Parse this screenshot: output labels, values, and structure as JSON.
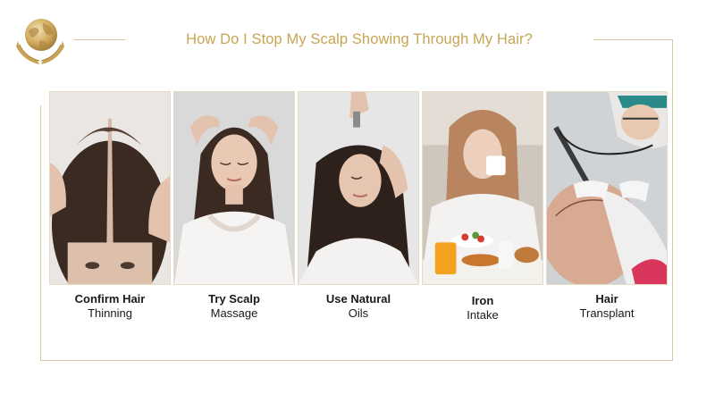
{
  "title": "How Do I Stop My Scalp Showing Through My Hair?",
  "accent_color": "#c8a553",
  "logo": {
    "icon": "globe-in-hands-icon"
  },
  "cards": [
    {
      "bold": "Confirm Hair",
      "regular": "Thinning"
    },
    {
      "bold": "Try Scalp",
      "regular": "Massage"
    },
    {
      "bold": "Use Natural",
      "regular": "Oils"
    },
    {
      "bold": "Iron",
      "regular": "Intake"
    },
    {
      "bold": "Hair",
      "regular": "Transplant"
    }
  ]
}
